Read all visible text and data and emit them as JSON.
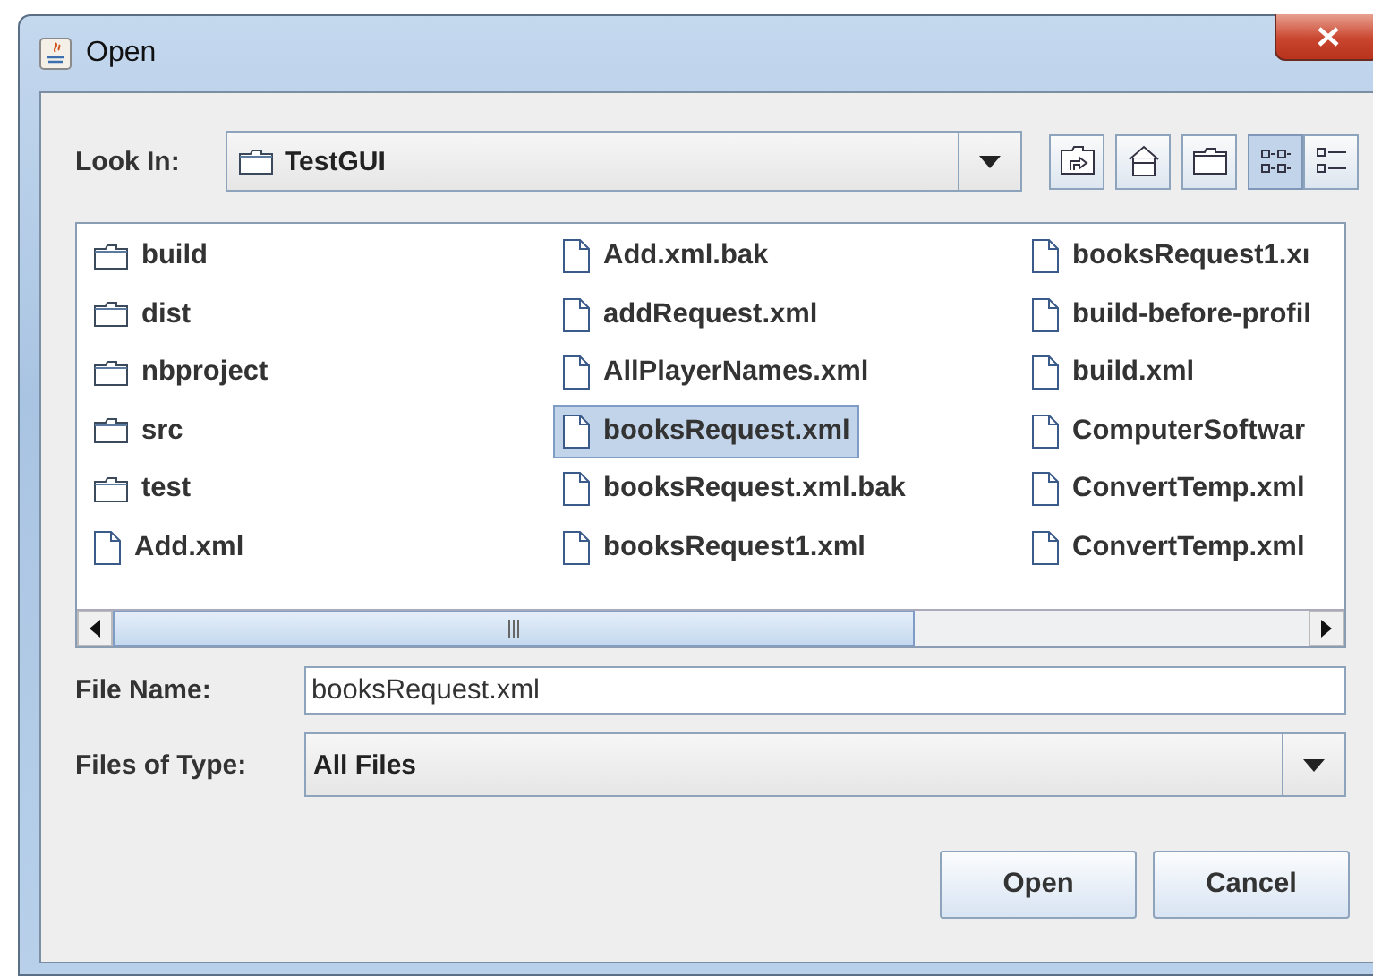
{
  "window": {
    "title": "Open"
  },
  "look_in": {
    "label": "Look In:",
    "value": "TestGUI"
  },
  "toolbar": [
    {
      "kind": "up",
      "selected": false
    },
    {
      "kind": "home",
      "selected": false
    },
    {
      "kind": "newfolder",
      "selected": false
    },
    {
      "kind": "list",
      "selected": true
    },
    {
      "kind": "details",
      "selected": false
    }
  ],
  "files": [
    {
      "name": "build",
      "kind": "folder",
      "selected": false
    },
    {
      "name": "dist",
      "kind": "folder",
      "selected": false
    },
    {
      "name": "nbproject",
      "kind": "folder",
      "selected": false
    },
    {
      "name": "src",
      "kind": "folder",
      "selected": false
    },
    {
      "name": "test",
      "kind": "folder",
      "selected": false
    },
    {
      "name": "Add.xml",
      "kind": "file",
      "selected": false
    },
    {
      "name": "Add.xml.bak",
      "kind": "file",
      "selected": false
    },
    {
      "name": "addRequest.xml",
      "kind": "file",
      "selected": false
    },
    {
      "name": "AllPlayerNames.xml",
      "kind": "file",
      "selected": false
    },
    {
      "name": "booksRequest.xml",
      "kind": "file",
      "selected": true
    },
    {
      "name": "booksRequest.xml.bak",
      "kind": "file",
      "selected": false
    },
    {
      "name": "booksRequest1.xml",
      "kind": "file",
      "selected": false
    },
    {
      "name": "booksRequest1.xı",
      "kind": "file",
      "selected": false
    },
    {
      "name": "build-before-profil",
      "kind": "file",
      "selected": false
    },
    {
      "name": "build.xml",
      "kind": "file",
      "selected": false
    },
    {
      "name": "ComputerSoftwar",
      "kind": "file",
      "selected": false
    },
    {
      "name": "ConvertTemp.xml",
      "kind": "file",
      "selected": false
    },
    {
      "name": "ConvertTemp.xml",
      "kind": "file",
      "selected": false
    }
  ],
  "file_name": {
    "label": "File Name:",
    "value": "booksRequest.xml"
  },
  "file_type": {
    "label": "Files of Type:",
    "value": "All Files"
  },
  "buttons": [
    "Open",
    "Cancel"
  ]
}
